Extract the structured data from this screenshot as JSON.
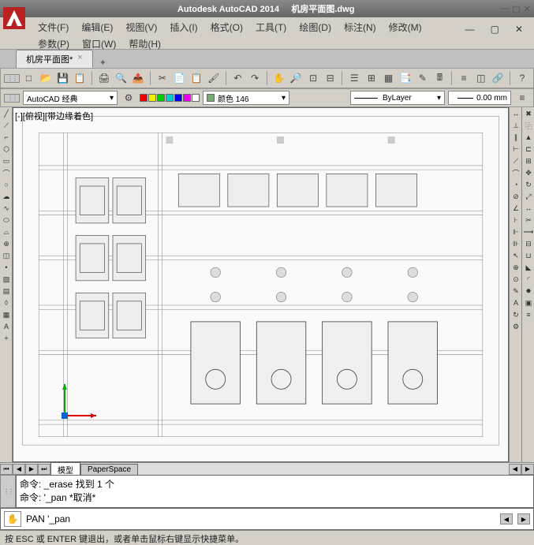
{
  "title_app": "Autodesk AutoCAD 2014",
  "title_file": "机房平面图.dwg",
  "menus": {
    "file": "文件(F)",
    "edit": "编辑(E)",
    "view": "视图(V)",
    "insert": "插入(I)",
    "format": "格式(O)",
    "tools": "工具(T)",
    "draw": "绘图(D)",
    "dimension": "标注(N)",
    "modify": "修改(M)",
    "param": "参数(P)",
    "window": "窗口(W)",
    "help": "帮助(H)"
  },
  "file_tab": {
    "name": "机房平面图*"
  },
  "workspace": "AutoCAD 经典",
  "color_label": "颜色 146",
  "layer_label": "ByLayer",
  "lineweight": "0.00 mm",
  "view_label": "[-][俯视][带边缘着色]",
  "model_tab": "模型",
  "paper_tab": "PaperSpace",
  "cmd_history": {
    "line1": "命令: _erase 找到 1 个",
    "line2": "命令: '_pan *取消*"
  },
  "cmd_prompt": "PAN '_pan",
  "status_text": "按 ESC 或 ENTER 键退出，或者单击鼠标右键显示快捷菜单。",
  "colors": {
    "red": "#e00",
    "yellow": "#ee0",
    "green": "#0c0",
    "cyan": "#0cc",
    "blue": "#00e",
    "magenta": "#e0e",
    "white": "#fff",
    "black": "#000"
  }
}
